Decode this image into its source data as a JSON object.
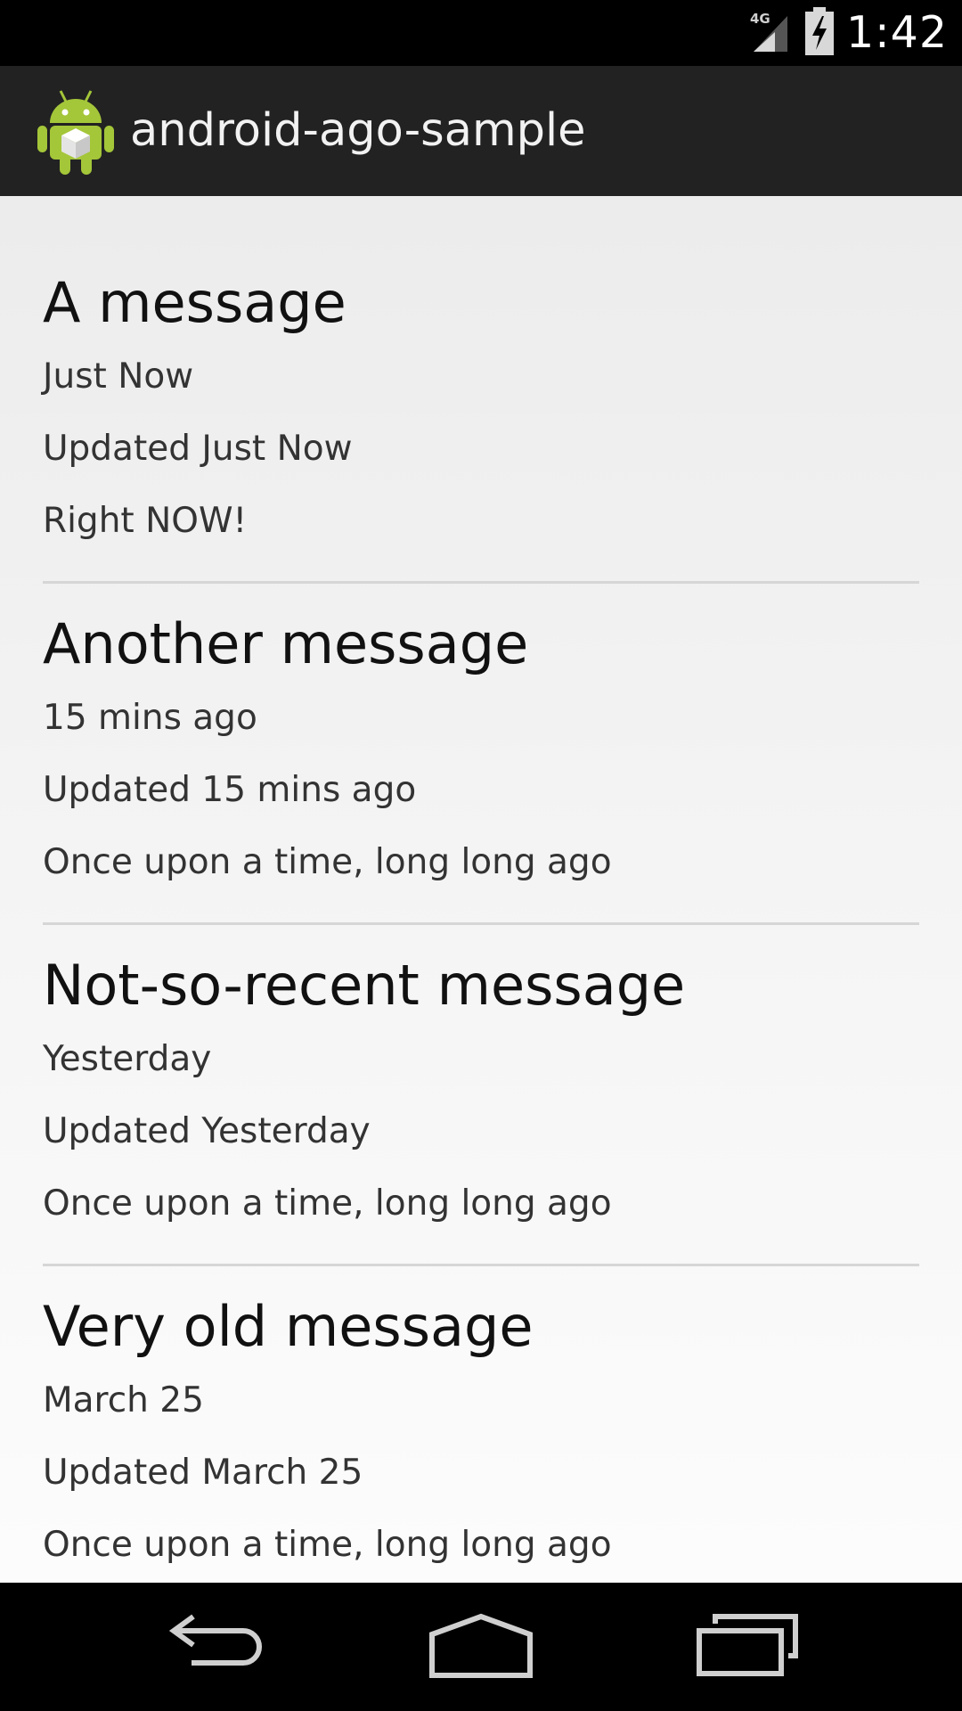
{
  "status_bar": {
    "network": "4G",
    "time": "1:42",
    "icons": [
      "signal-icon",
      "battery-charging-icon"
    ]
  },
  "action_bar": {
    "title": "android-ago-sample",
    "icon": "android-app-icon"
  },
  "messages": [
    {
      "title": "A message",
      "lines": [
        "Just Now",
        "Updated Just Now",
        "Right NOW!"
      ]
    },
    {
      "title": "Another message",
      "lines": [
        "15 mins ago",
        "Updated 15 mins ago",
        "Once upon a time, long long ago"
      ]
    },
    {
      "title": "Not-so-recent message",
      "lines": [
        "Yesterday",
        "Updated Yesterday",
        "Once upon a time, long long ago"
      ]
    },
    {
      "title": "Very old message",
      "lines": [
        "March 25",
        "Updated March 25",
        "Once upon a time, long long ago"
      ]
    }
  ],
  "nav_bar": {
    "buttons": [
      "back-icon",
      "home-icon",
      "recents-icon"
    ]
  },
  "colors": {
    "status_bar": "#000000",
    "action_bar": "#222222",
    "android_green": "#a4c639",
    "content_bg": "#f0f0f0"
  }
}
